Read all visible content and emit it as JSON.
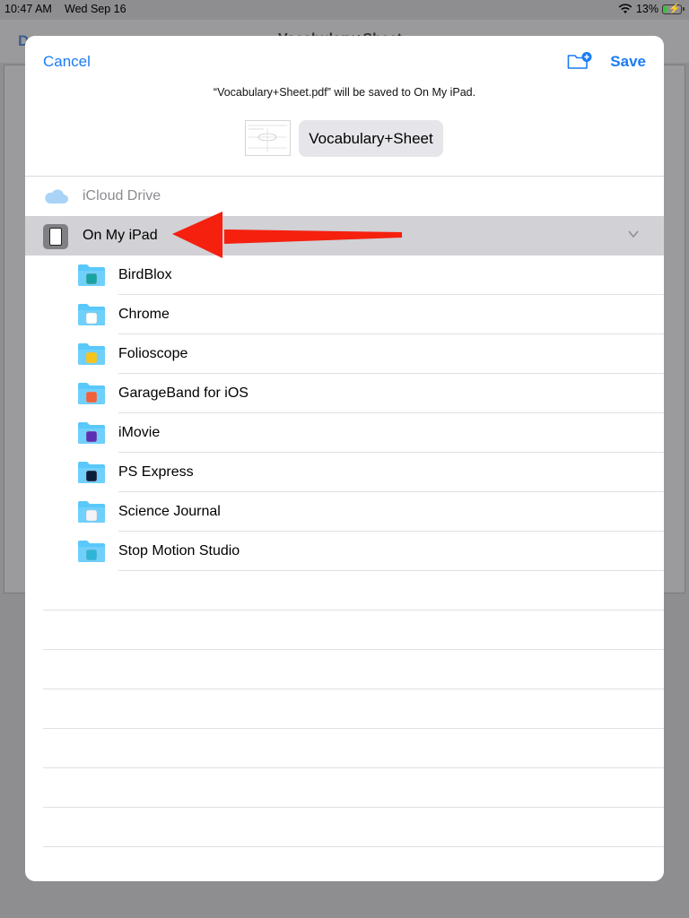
{
  "status_bar": {
    "time": "10:47 AM",
    "date": "Wed Sep 16",
    "battery": "13%",
    "battery_level": 0.13
  },
  "background_app": {
    "left_button": "D",
    "title": "Vocabulary+Sheet"
  },
  "sheet": {
    "cancel_label": "Cancel",
    "save_label": "Save",
    "new_folder_icon": "folder-plus-icon",
    "save_message": "“Vocabulary+Sheet.pdf” will be saved to On My iPad.",
    "file_name": "Vocabulary+Sheet"
  },
  "locations": [
    {
      "label": "iCloud Drive",
      "icon": "icloud-icon",
      "enabled": false
    },
    {
      "label": "On My iPad",
      "icon": "ipad-icon",
      "selected": true
    }
  ],
  "folders": [
    {
      "label": "BirdBlox",
      "badge_color": "#1aa3a3"
    },
    {
      "label": "Chrome",
      "badge_color": "#ffffff"
    },
    {
      "label": "Folioscope",
      "badge_color": "#f5c51b"
    },
    {
      "label": "GarageBand for iOS",
      "badge_color": "#f0603a"
    },
    {
      "label": "iMovie",
      "badge_color": "#5b2fb4"
    },
    {
      "label": "PS Express",
      "badge_color": "#0b1f3a"
    },
    {
      "label": "Science Journal",
      "badge_color": "#f3f3f8"
    },
    {
      "label": "Stop Motion Studio",
      "badge_color": "#2eb5d8"
    }
  ],
  "annotation": {
    "type": "arrow",
    "color": "#f5200e",
    "points_to": "On My iPad"
  },
  "colors": {
    "accent": "#1a7cf5",
    "selected_row": "#d1d1d6",
    "folder": "#5ac8fa"
  }
}
